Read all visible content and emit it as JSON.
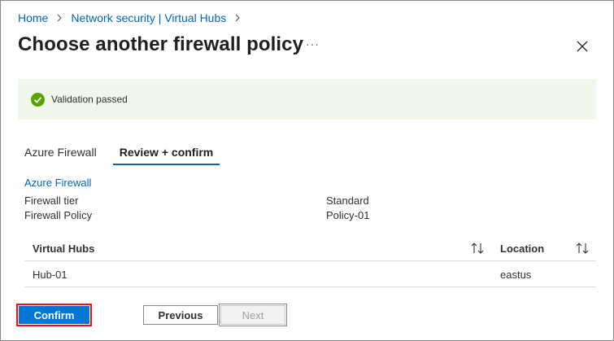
{
  "breadcrumb": {
    "items": [
      "Home",
      "Network security | Virtual Hubs"
    ]
  },
  "page": {
    "title": "Choose another firewall policy",
    "more_label": "···"
  },
  "validation": {
    "message": "Validation passed",
    "status_color": "#57a300"
  },
  "tabs": [
    {
      "label": "Azure Firewall",
      "active": false
    },
    {
      "label": "Review + confirm",
      "active": true
    }
  ],
  "review": {
    "section_title": "Azure Firewall",
    "fields": [
      {
        "label": "Firewall tier",
        "value": "Standard"
      },
      {
        "label": "Firewall Policy",
        "value": "Policy-01"
      }
    ]
  },
  "grid": {
    "columns": [
      "Virtual Hubs",
      "Location"
    ],
    "rows": [
      [
        "Hub-01",
        "eastus"
      ]
    ]
  },
  "footer": {
    "confirm_label": "Confirm",
    "previous_label": "Previous",
    "next_label": "Next"
  },
  "colors": {
    "accent": "#0078d4",
    "link": "#0067b8",
    "banner_bg": "#f1f8eb"
  }
}
